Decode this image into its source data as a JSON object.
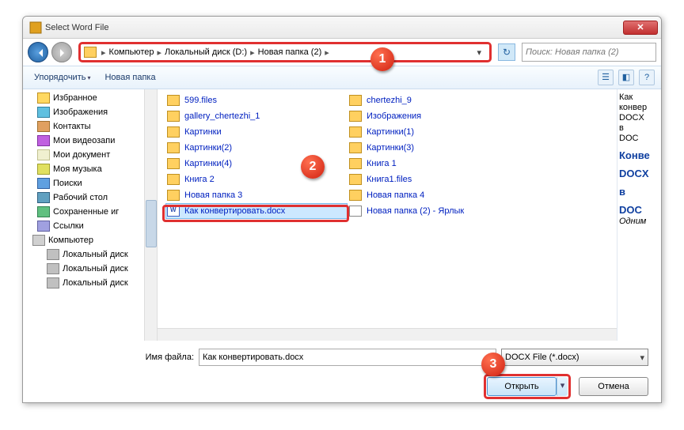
{
  "title": "Select Word File",
  "breadcrumbs": [
    "Компьютер",
    "Локальный диск (D:)",
    "Новая папка (2)"
  ],
  "search_placeholder": "Поиск: Новая папка (2)",
  "toolbar": {
    "organize": "Упорядочить",
    "new_folder": "Новая папка"
  },
  "tree": [
    {
      "label": "Избранное",
      "icon": "fav",
      "l": 1
    },
    {
      "label": "Изображения",
      "icon": "pic",
      "l": 1
    },
    {
      "label": "Контакты",
      "icon": "cont",
      "l": 1
    },
    {
      "label": "Мои видеозапи",
      "icon": "vid",
      "l": 1
    },
    {
      "label": "Мои документ",
      "icon": "doc",
      "l": 1
    },
    {
      "label": "Моя музыка",
      "icon": "mus",
      "l": 1
    },
    {
      "label": "Поиски",
      "icon": "search",
      "l": 1
    },
    {
      "label": "Рабочий стол",
      "icon": "desk",
      "l": 1
    },
    {
      "label": "Сохраненные иг",
      "icon": "save",
      "l": 1
    },
    {
      "label": "Ссылки",
      "icon": "link",
      "l": 1
    },
    {
      "label": "Компьютер",
      "icon": "comp",
      "l": 0
    },
    {
      "label": "Локальный диск",
      "icon": "disk",
      "l": 2
    },
    {
      "label": "Локальный диск",
      "icon": "disk",
      "l": 2
    },
    {
      "label": "Локальный диск",
      "icon": "disk",
      "l": 2
    }
  ],
  "files_col1": [
    {
      "label": "599.files",
      "icon": "f"
    },
    {
      "label": "gallery_chertezhi_1",
      "icon": "f"
    },
    {
      "label": "Картинки",
      "icon": "f"
    },
    {
      "label": "Картинки(2)",
      "icon": "f"
    },
    {
      "label": "Картинки(4)",
      "icon": "f"
    },
    {
      "label": "Книга 2",
      "icon": "f"
    },
    {
      "label": "Новая папка 3",
      "icon": "f"
    },
    {
      "label": "Как конвертировать.docx",
      "icon": "wd",
      "selected": true
    }
  ],
  "files_col2": [
    {
      "label": "chertezhi_9",
      "icon": "f"
    },
    {
      "label": "Изображения",
      "icon": "f"
    },
    {
      "label": "Картинки(1)",
      "icon": "f"
    },
    {
      "label": "Картинки(3)",
      "icon": "f"
    },
    {
      "label": "Книга 1",
      "icon": "f"
    },
    {
      "label": "Книга1.files",
      "icon": "f"
    },
    {
      "label": "Новая папка 4",
      "icon": "f"
    },
    {
      "label": "Новая папка (2) - Ярлык",
      "icon": "sc"
    }
  ],
  "preview": {
    "l1": "Как",
    "l2": "конвер",
    "l3": "DOCX",
    "l4": "в",
    "l5": "DOC",
    "h": "Конве",
    "h2": "DOCX",
    "h3": "в",
    "h4": "DOC",
    "it": "Одним"
  },
  "filename_label": "Имя файла:",
  "filename_value": "Как конвертировать.docx",
  "filetype": "DOCX File (*.docx)",
  "open_button": "Открыть",
  "cancel_button": "Отмена",
  "markers": {
    "1": "1",
    "2": "2",
    "3": "3"
  }
}
